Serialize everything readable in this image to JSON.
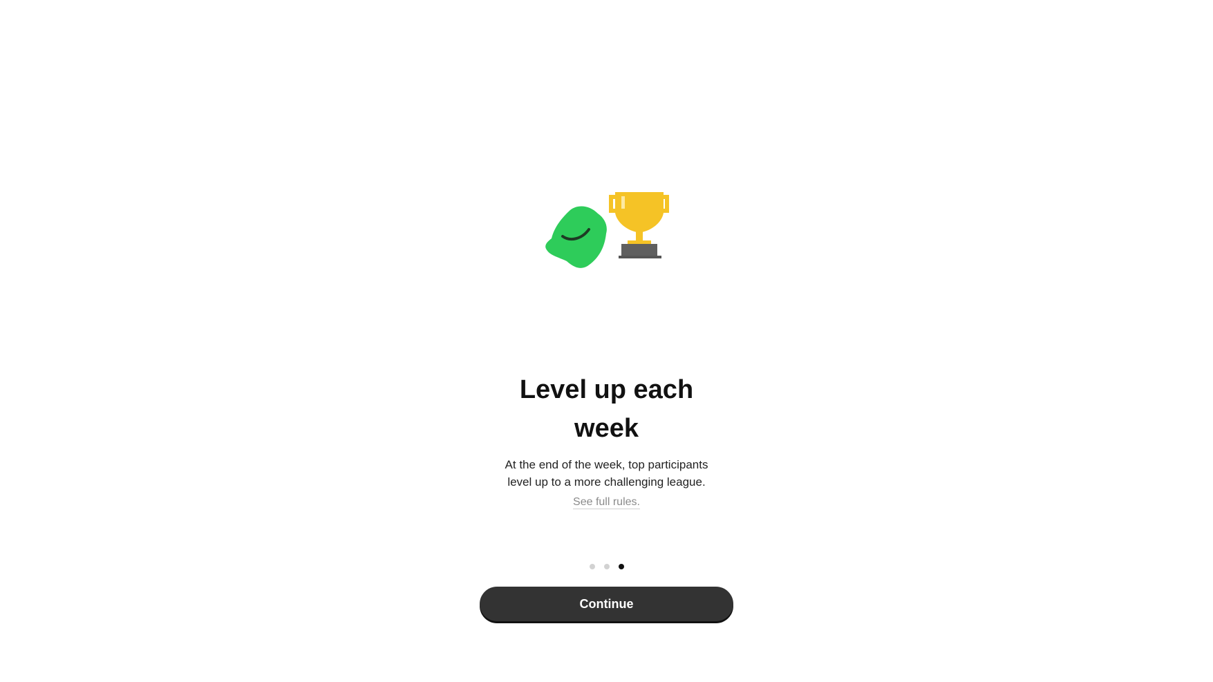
{
  "onboarding": {
    "title_lines": [
      "Level up each",
      "week"
    ],
    "description_lines": [
      "At the end of the week, top participants",
      "level up to a more challenging league."
    ],
    "rules_link": "See full rules.",
    "continue_label": "Continue",
    "pagination": {
      "total": 3,
      "current": 3
    }
  },
  "illustration": {
    "icons": [
      "blob-mascot-icon",
      "trophy-icon"
    ],
    "colors": {
      "blob": "#2ecc5a",
      "trophy": "#f5c326",
      "base": "#5f5f5f"
    }
  },
  "colors": {
    "button": "#333333",
    "dot_active": "#111111",
    "dot_inactive": "#d2d2d2"
  }
}
